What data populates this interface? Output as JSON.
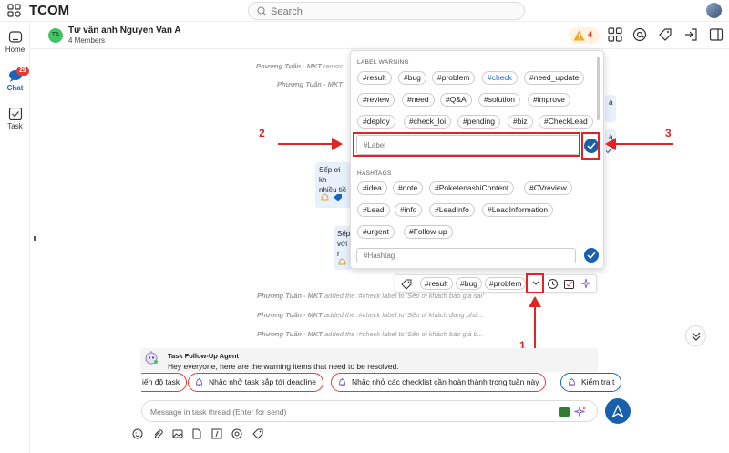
{
  "app": {
    "title": "TCOM"
  },
  "search": {
    "placeholder": "Search"
  },
  "rail": {
    "home_label": "Home",
    "chat_label": "Chat",
    "chat_badge": "29",
    "task_label": "Task"
  },
  "header": {
    "avatar_initials": "TA",
    "group_name": "Tư vấn anh Nguyen Van A",
    "members": "4 Members",
    "warning_count": "4"
  },
  "system_messages": [
    {
      "author": "Phương Tuấn - MKT",
      "text": " remov"
    },
    {
      "author": "Phương Tuấn - MKT",
      "text": ""
    },
    {
      "author": "Phương Tuấn - MKT",
      "text": " added the :#check label to 'Sếp ơi khách báo giá sai'"
    },
    {
      "author": "Phương Tuấn - MKT",
      "text": " added the :#check label to 'Sếp ơi khách đang phả..."
    },
    {
      "author": "Phương Tuấn - MKT",
      "text": " added the :#check label to 'Sếp ơi khách báo giá b..."
    }
  ],
  "bubbles": [
    {
      "line1": "Sếp ơi kh",
      "line2": "nhiều tiề"
    },
    {
      "line1": "Sếp",
      "line2": "với r"
    }
  ],
  "bubble_fragments": {
    "right_a": "á",
    "right_b": "ả"
  },
  "popup": {
    "label_section_title": "LABEL WARNING",
    "label_chips": [
      "#result",
      "#bug",
      "#problem",
      "#check",
      "#need_update",
      "#review",
      "#need",
      "#Q&A",
      "#solution",
      "#improve",
      "#deploy",
      "#check_loi",
      "#pending",
      "#biz",
      "#CheckLead"
    ],
    "label_input_placeholder": "#Label",
    "hashtag_section_title": "HASHTAGS",
    "hashtag_chips": [
      "#idea",
      "#note",
      "#PoketenashiContent",
      "#CVreview",
      "#Lead",
      "#info",
      "#LeadInfo",
      "#LeadInformation",
      "#urgent",
      "#Follow-up"
    ],
    "hashtag_input_placeholder": "#Hashtag"
  },
  "tag_toolbar": {
    "chips": [
      "#result",
      "#bug",
      "#problem"
    ]
  },
  "annotations": {
    "n1": "1",
    "n2": "2",
    "n3": "3"
  },
  "agent": {
    "name": "Task Follow-Up Agent",
    "message": "Hey everyone, here are the warning items that need to be resolved."
  },
  "quick_chips": [
    "iến độ task",
    "Nhắc nhở task sắp tới deadline",
    "Nhắc nhở các checklist cần hoàn thành trong tuần này",
    "Kiểm tra t"
  ],
  "composer": {
    "placeholder": "Message in task thread (Enter for send)"
  },
  "colors": {
    "accent": "#1a5fab",
    "annotation": "#e02424",
    "bubble": "#e7f1fc"
  }
}
